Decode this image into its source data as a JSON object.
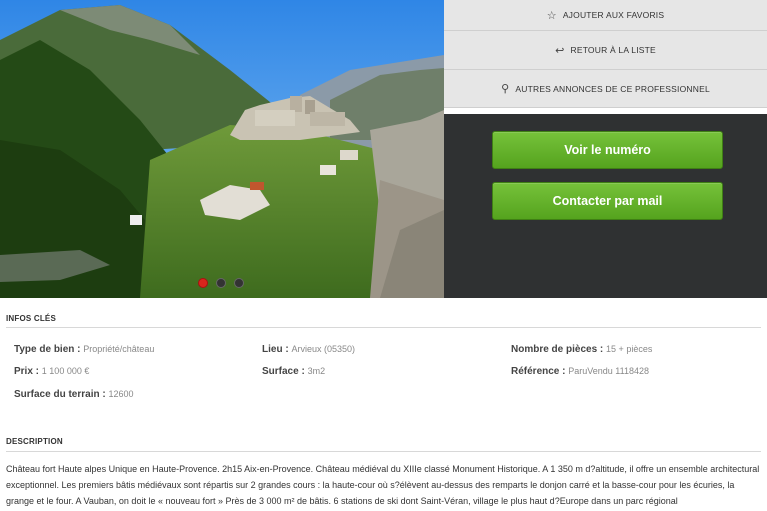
{
  "gallery": {
    "slide_count": 3,
    "active_index": 0
  },
  "actions": {
    "favorites": {
      "icon": "star-icon",
      "label": "AJOUTER AUX FAVORIS"
    },
    "back": {
      "icon": "return-icon",
      "label": "RETOUR À LA LISTE"
    },
    "other_ads": {
      "icon": "search-icon",
      "label": "AUTRES ANNONCES DE CE PROFESSIONNEL"
    }
  },
  "contact": {
    "phone_label": "Voir le numéro",
    "mail_label": "Contacter par mail",
    "color": "#62b22b"
  },
  "infos": {
    "title": "INFOS CLÉS",
    "type": {
      "label": "Type de bien :",
      "value": "Propriété/château"
    },
    "lieu": {
      "label": "Lieu :",
      "value": "Arvieux (05350)"
    },
    "pieces": {
      "label": "Nombre de pièces :",
      "value": "15 + pièces"
    },
    "prix": {
      "label": "Prix :",
      "value": "1 100 000 €"
    },
    "surface": {
      "label": "Surface :",
      "value": "3m2"
    },
    "reference": {
      "label": "Référence :",
      "value": "ParuVendu 1118428"
    },
    "terrain": {
      "label": "Surface du terrain :",
      "value": "12600"
    }
  },
  "description": {
    "title": "DESCRIPTION",
    "text": "Château fort Haute alpes Unique en Haute-Provence. 2h15 Aix-en-Provence. Château médiéval du XIIIe classé Monument Historique. A 1 350 m d?altitude, il offre un ensemble architectural exceptionnel. Les premiers bâtis médiévaux sont répartis sur 2 grandes cours : la haute-cour où s?élèvent au-dessus des remparts le donjon carré et la basse-cour pour les écuries, la grange et le four. A Vauban, on doit le « nouveau fort » Près de 3 000 m² de bâtis. 6 stations de ski dont Saint-Véran, village le plus haut d?Europe dans un parc régional"
  }
}
